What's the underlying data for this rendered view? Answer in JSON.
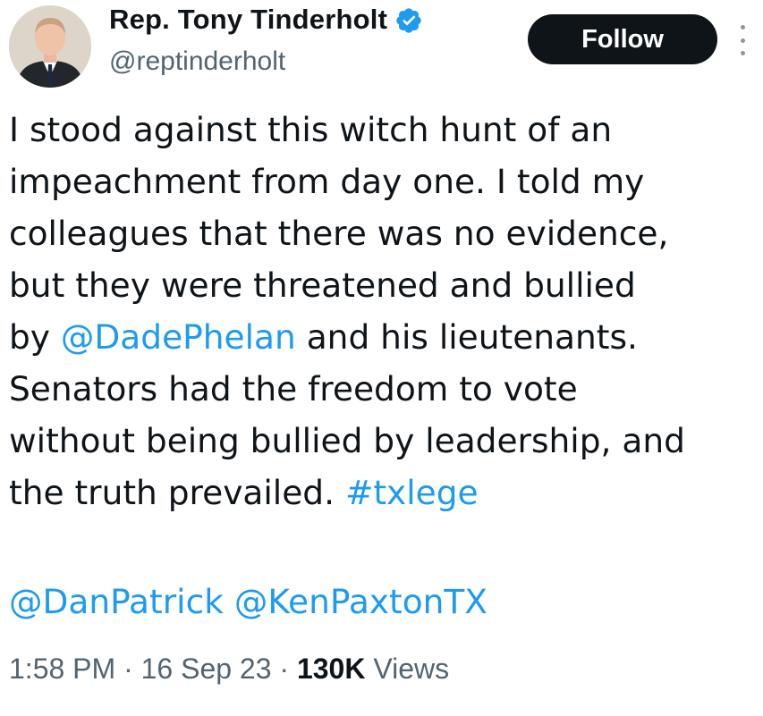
{
  "author": {
    "display_name": "Rep. Tony Tinderholt",
    "handle": "@reptinderholt",
    "verified_icon": "verified-badge-icon",
    "verified_color": "#1d9bf0"
  },
  "actions": {
    "follow_label": "Follow",
    "more_icon": "more-options-icon"
  },
  "tweet": {
    "line1": "I stood against this witch hunt of an",
    "line2": "impeachment from day one. I told my",
    "line3": "colleagues that there was no evidence,",
    "line4": "but they were threatened and bullied",
    "line5_before": "by ",
    "line5_mention": "@DadePhelan",
    "line5_after": " and his lieutenants.",
    "line6": "Senators had the freedom to vote",
    "line7": "without being bullied by leadership, and",
    "line8_before": "the truth prevailed. ",
    "line8_hashtag": "#txlege",
    "mention1": "@DanPatrick",
    "mention2": "@KenPaxtonTX"
  },
  "meta": {
    "time": "1:58 PM",
    "separator": " · ",
    "date": "16 Sep 23",
    "views_count": "130K",
    "views_label": " Views"
  },
  "colors": {
    "link": "#1d9bf0",
    "text": "#0f1419",
    "secondary": "#536471"
  }
}
